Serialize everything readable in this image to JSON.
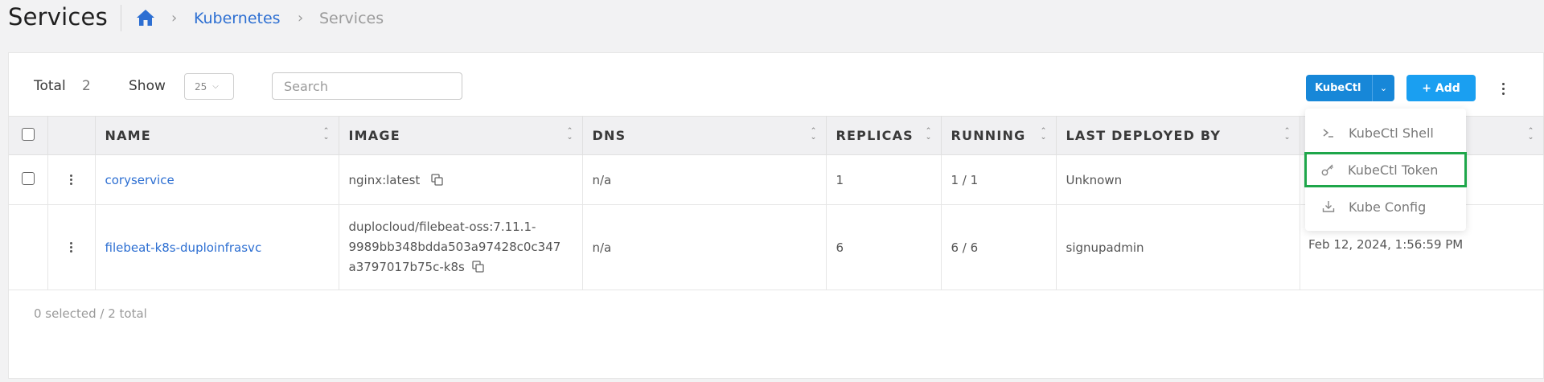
{
  "header": {
    "title": "Services",
    "breadcrumb": [
      "Kubernetes",
      "Services"
    ]
  },
  "toolbar": {
    "total_label": "Total",
    "total_value": "2",
    "show_label": "Show",
    "page_size": "25",
    "search_placeholder": "Search",
    "kubectl_label": "KubeCtl",
    "add_label": "+ Add"
  },
  "table": {
    "columns": [
      "NAME",
      "IMAGE",
      "DNS",
      "REPLICAS",
      "RUNNING",
      "LAST DEPLOYED BY"
    ],
    "rows": [
      {
        "name": "coryservice",
        "image": "nginx:latest",
        "dns": "n/a",
        "replicas": "1",
        "running": "1 / 1",
        "last_deployed_by": "Unknown"
      },
      {
        "name": "filebeat-k8s-duploinfrasvc",
        "image_lines": [
          "duplocloud/filebeat-oss:7.11.1-",
          "9989bb348bdda503a97428c0c347",
          "a3797017b75c-k8s"
        ],
        "dns": "n/a",
        "replicas": "6",
        "running": "6 / 6",
        "last_deployed_by": "signupadmin",
        "last_deployed_at": "Feb 12, 2024, 1:56:59 PM"
      }
    ]
  },
  "footer": {
    "selection_info": "0 selected / 2 total"
  },
  "kubectl_menu": {
    "items": [
      {
        "label": "KubeCtl Shell",
        "icon": "terminal-icon"
      },
      {
        "label": "KubeCtl Token",
        "icon": "key-icon",
        "highlighted": true
      },
      {
        "label": "Kube Config",
        "icon": "download-icon"
      }
    ]
  },
  "colors": {
    "accent": "#1787d8",
    "link": "#2d6fd2",
    "highlight": "#1ea64a"
  }
}
